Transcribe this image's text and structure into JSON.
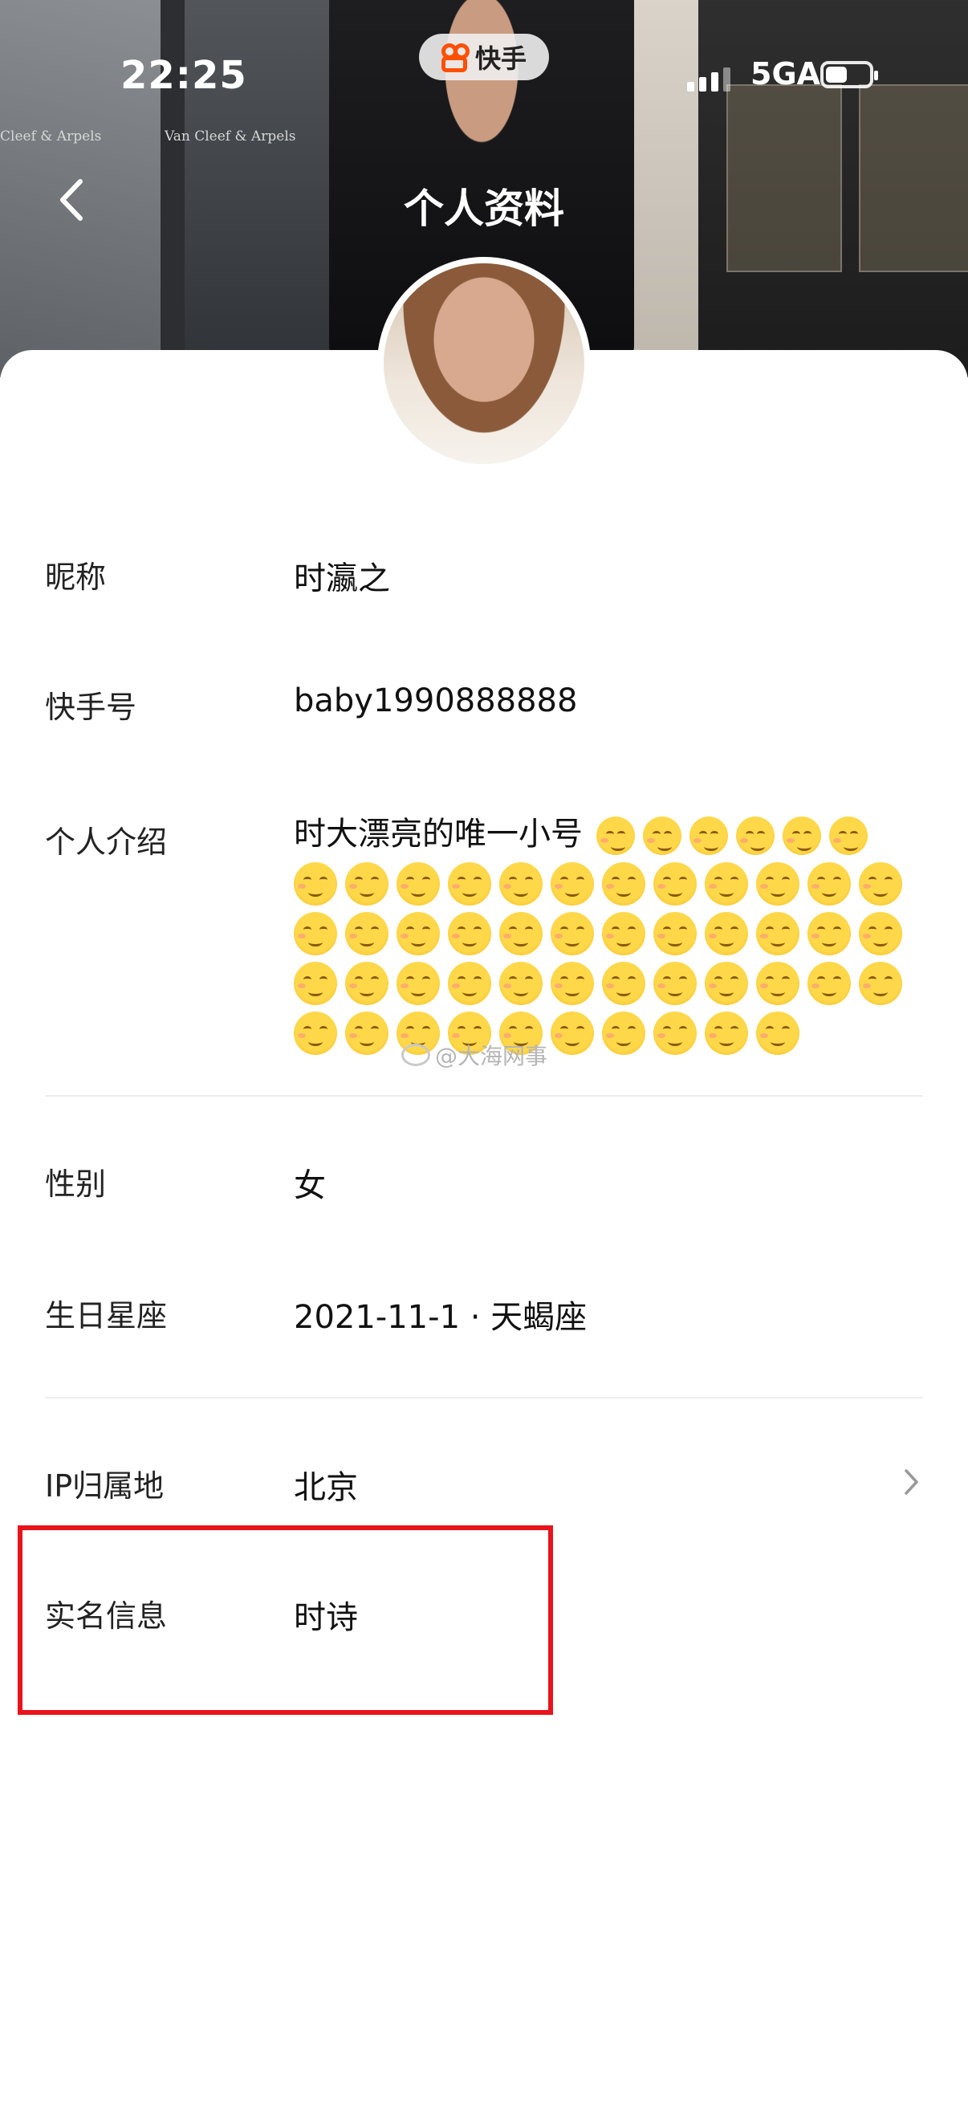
{
  "status_bar": {
    "time": "22:25",
    "app_badge": "快手",
    "network": "5GA",
    "signal_bars": 4,
    "battery_level": 0.5
  },
  "nav": {
    "title": "个人资料"
  },
  "profile": {
    "nickname_label": "昵称",
    "nickname_value": "时瀛之",
    "kuaishou_id_label": "快手号",
    "kuaishou_id_value": "baby1990888888",
    "bio_label": "个人介绍",
    "bio_value": "时大漂亮的唯一小号",
    "bio_emoji_count": 53,
    "gender_label": "性别",
    "gender_value": "女",
    "birthday_label": "生日星座",
    "birthday_value": "2021-11-1 · 天蝎座",
    "ip_label": "IP归属地",
    "ip_value": "北京",
    "realname_label": "实名信息",
    "realname_value": "时诗"
  },
  "watermark": "@大海网事",
  "hero_signs": [
    "Cleef & Arpels",
    "Van Cleef & Arpels"
  ],
  "colors": {
    "highlight": "#e8131b",
    "brand": "#ff5000"
  }
}
